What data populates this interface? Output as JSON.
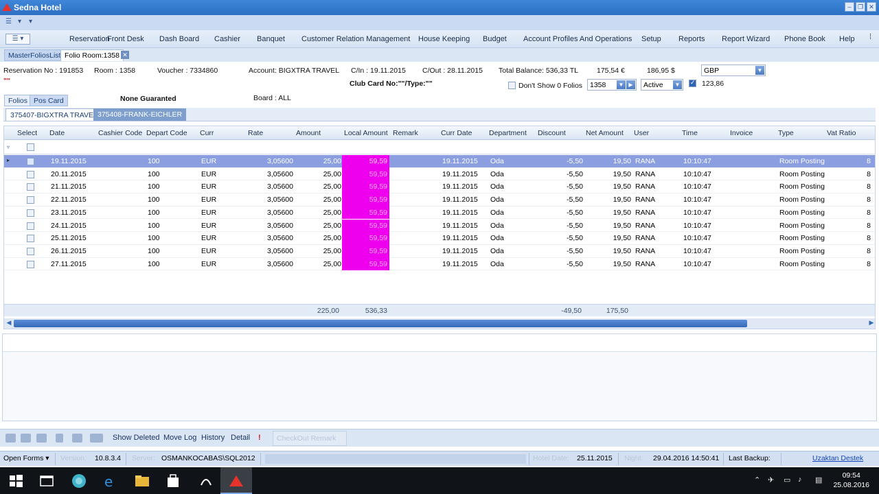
{
  "window": {
    "title": "Sedna Hotel",
    "controls": [
      "–",
      "❐",
      "✕"
    ]
  },
  "menu": {
    "toggle_label": "☰ ▾",
    "items": [
      "Reservation",
      "Front Desk",
      "Dash Board",
      "Cashier",
      "Banquet",
      "Customer Relation Management",
      "House Keeping",
      "Budget",
      "Account Profiles And Operations",
      "Setup",
      "Reports",
      "Report Wizard",
      "Phone Book",
      "Help"
    ]
  },
  "doc_tabs": {
    "list": "MasterFoliosList",
    "current": "Folio Room:1358",
    "close": "✕"
  },
  "reservation": {
    "reservation_no": "Reservation No :  191853",
    "room": "Room :  1358",
    "voucher": "Voucher : 7334860",
    "account": "Account:  BIGXTRA TRAVEL",
    "checkin": "C/In :      19.11.2015",
    "checkout": "C/Out :       28.11.2015",
    "total_balance": "Total Balance:  536,33 TL",
    "balance_eur": "175,54 €",
    "balance_usd": "186,95 $",
    "currency": "GBP",
    "club_card": "Club Card No:\"\"/Type:\"\"",
    "red_quotes": "\"\"",
    "dont_show_zero": "Don't Show 0 Folios",
    "room_select": "1358",
    "status_select": "Active",
    "gbp_value": "123,86",
    "guarantee": "None Guaranted",
    "board": "Board :  ALL"
  },
  "sub_tabs": [
    "Folios",
    "Pos Card"
  ],
  "folio_tabs": [
    "375407-BIGXTRA TRAVEL",
    "375408-FRANK-EICHLER"
  ],
  "grid": {
    "columns": [
      "Select",
      "Date",
      "Cashier Code",
      "Depart Code",
      "Curr",
      "Rate",
      "Amount",
      "Local Amount",
      "Remark",
      "Curr Date",
      "Department",
      "Discount",
      "Net Amount",
      "User",
      "Time",
      "Invoice",
      "Type",
      "Vat Ratio"
    ],
    "rows": [
      {
        "date": "19.11.2015",
        "depart": "100",
        "curr": "EUR",
        "rate": "3,05600",
        "amount": "25,00",
        "local": "59,59",
        "curr_date": "19.11.2015",
        "dept": "Oda",
        "discount": "-5,50",
        "net": "19,50",
        "user": "RANA",
        "time": "10:10:47",
        "type": "Room Posting",
        "vat": "8"
      },
      {
        "date": "20.11.2015",
        "depart": "100",
        "curr": "EUR",
        "rate": "3,05600",
        "amount": "25,00",
        "local": "59,59",
        "curr_date": "19.11.2015",
        "dept": "Oda",
        "discount": "-5,50",
        "net": "19,50",
        "user": "RANA",
        "time": "10:10:47",
        "type": "Room Posting",
        "vat": "8"
      },
      {
        "date": "21.11.2015",
        "depart": "100",
        "curr": "EUR",
        "rate": "3,05600",
        "amount": "25,00",
        "local": "59,59",
        "curr_date": "19.11.2015",
        "dept": "Oda",
        "discount": "-5,50",
        "net": "19,50",
        "user": "RANA",
        "time": "10:10:47",
        "type": "Room Posting",
        "vat": "8"
      },
      {
        "date": "22.11.2015",
        "depart": "100",
        "curr": "EUR",
        "rate": "3,05600",
        "amount": "25,00",
        "local": "59,59",
        "curr_date": "19.11.2015",
        "dept": "Oda",
        "discount": "-5,50",
        "net": "19,50",
        "user": "RANA",
        "time": "10:10:47",
        "type": "Room Posting",
        "vat": "8"
      },
      {
        "date": "23.11.2015",
        "depart": "100",
        "curr": "EUR",
        "rate": "3,05600",
        "amount": "25,00",
        "local": "59,59",
        "curr_date": "19.11.2015",
        "dept": "Oda",
        "discount": "-5,50",
        "net": "19,50",
        "user": "RANA",
        "time": "10:10:47",
        "type": "Room Posting",
        "vat": "8"
      },
      {
        "date": "24.11.2015",
        "depart": "100",
        "curr": "EUR",
        "rate": "3,05600",
        "amount": "25,00",
        "local": "59,59",
        "curr_date": "19.11.2015",
        "dept": "Oda",
        "discount": "-5,50",
        "net": "19,50",
        "user": "RANA",
        "time": "10:10:47",
        "type": "Room Posting",
        "vat": "8"
      },
      {
        "date": "25.11.2015",
        "depart": "100",
        "curr": "EUR",
        "rate": "3,05600",
        "amount": "25,00",
        "local": "59,59",
        "curr_date": "19.11.2015",
        "dept": "Oda",
        "discount": "-5,50",
        "net": "19,50",
        "user": "RANA",
        "time": "10:10:47",
        "type": "Room Posting",
        "vat": "8"
      },
      {
        "date": "26.11.2015",
        "depart": "100",
        "curr": "EUR",
        "rate": "3,05600",
        "amount": "25,00",
        "local": "59,59",
        "curr_date": "19.11.2015",
        "dept": "Oda",
        "discount": "-5,50",
        "net": "19,50",
        "user": "RANA",
        "time": "10:10:47",
        "type": "Room Posting",
        "vat": "8"
      },
      {
        "date": "27.11.2015",
        "depart": "100",
        "curr": "EUR",
        "rate": "3,05600",
        "amount": "25,00",
        "local": "59,59",
        "curr_date": "19.11.2015",
        "dept": "Oda",
        "discount": "-5,50",
        "net": "19,50",
        "user": "RANA",
        "time": "10:10:47",
        "type": "Room Posting",
        "vat": "8"
      }
    ],
    "totals": {
      "amount": "225,00",
      "local": "536,33",
      "discount": "-49,50",
      "net": "175,50"
    }
  },
  "actions": {
    "show_deleted": "Show Deleted",
    "move_log": "Move Log",
    "history": "History",
    "detail": "Detail",
    "alert": "!",
    "checkout_remark": "CheckOut Remark"
  },
  "status": {
    "open_forms": "Open Forms ▾",
    "version_label": "Version:",
    "version": "10.8.3.4",
    "server_label": "Server:",
    "server": "OSMANKOCABAS\\SQL2012",
    "hotel_date_label": "Hotel Date:",
    "hotel_date": "25.11.2015",
    "night_label": "Night:",
    "night": "29.04.2016 14:50:41",
    "last_backup": "Last Backup:",
    "remote": "Uzaktan Destek"
  },
  "taskbar": {
    "time": "09:54",
    "date": "25.08.2016"
  },
  "colors": {
    "local_amount": "#ee00ee",
    "selected_row": "#8b9ee0",
    "title_bar": "#2c6fc4"
  }
}
